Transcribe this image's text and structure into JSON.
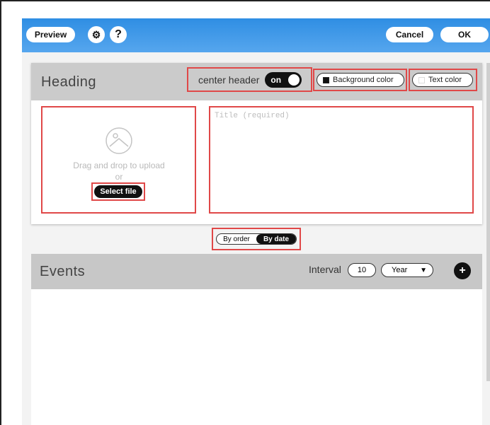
{
  "toolbar": {
    "preview_label": "Preview",
    "settings_icon": "gear-icon",
    "help_label": "?",
    "cancel_label": "Cancel",
    "ok_label": "OK"
  },
  "heading": {
    "title": "Heading",
    "center_header_label": "center header",
    "center_header_state": "on",
    "background_color_label": "Background color",
    "text_color_label": "Text color",
    "upload_text": "Drag and drop to upload",
    "upload_or": "or",
    "select_file_label": "Select file",
    "title_placeholder": "Title (required)"
  },
  "sort": {
    "options": [
      "By order",
      "By date"
    ],
    "selected": "By date"
  },
  "events": {
    "title": "Events",
    "interval_label": "Interval",
    "interval_value": "10",
    "interval_unit": "Year",
    "add_icon": "plus-icon"
  },
  "colors": {
    "toolbar_blue": "#2f8ee3",
    "highlight_red": "#e04848",
    "header_gray": "#cbcbcb"
  }
}
